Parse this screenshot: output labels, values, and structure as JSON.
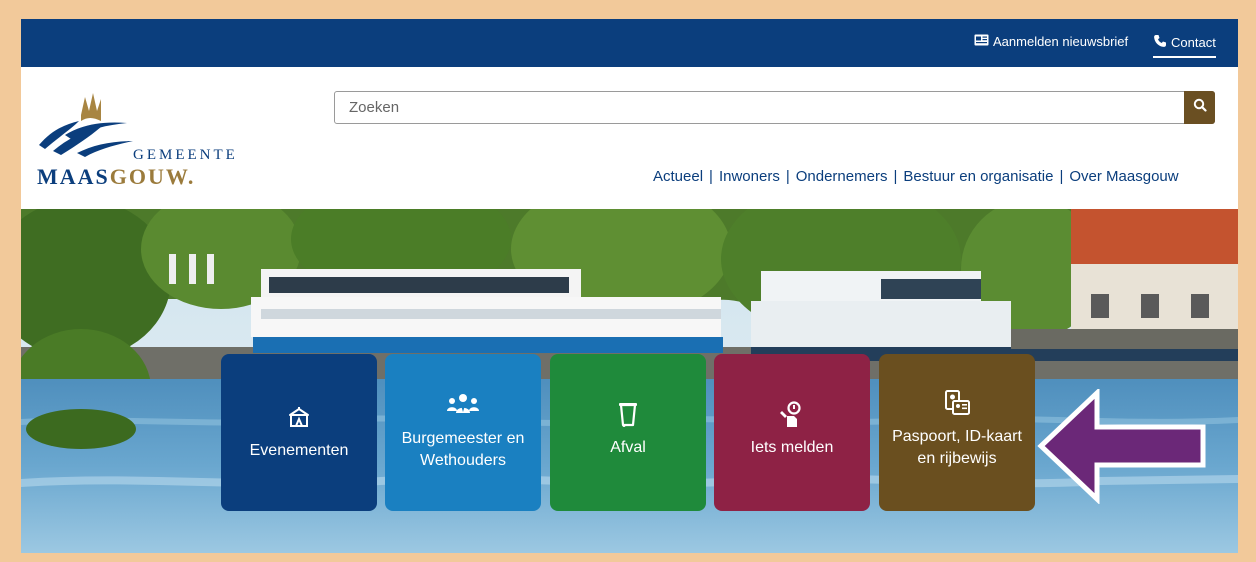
{
  "topbar": {
    "newsletter_label": "Aanmelden nieuwsbrief",
    "contact_label": "Contact"
  },
  "logo": {
    "line1": "GEMEENTE",
    "line2_a": "MAAS",
    "line2_b": "GOUW.",
    "alt": "Gemeente Maasgouw"
  },
  "search": {
    "placeholder": "Zoeken"
  },
  "nav": {
    "items": [
      "Actueel",
      "Inwoners",
      "Ondernemers",
      "Bestuur en organisatie",
      "Over Maasgouw"
    ]
  },
  "tiles": [
    {
      "label": "Evenementen",
      "icon": "tent-icon",
      "color": "#0b3e7d"
    },
    {
      "label": "Burgemeester en Wethouders",
      "icon": "people-icon",
      "color": "#1a80c1"
    },
    {
      "label": "Afval",
      "icon": "trash-bin-icon",
      "color": "#1f8a3b"
    },
    {
      "label": "Iets melden",
      "icon": "report-person-icon",
      "color": "#8e2245"
    },
    {
      "label": "Paspoort, ID-kaart en rijbewijs",
      "icon": "id-card-icon",
      "color": "#6a4f1f"
    }
  ],
  "annotation": {
    "arrow_color": "#6b2878"
  },
  "colors": {
    "brand_blue": "#0b3e7d",
    "search_button": "#6a4f22",
    "frame_border": "#f2c99a"
  }
}
